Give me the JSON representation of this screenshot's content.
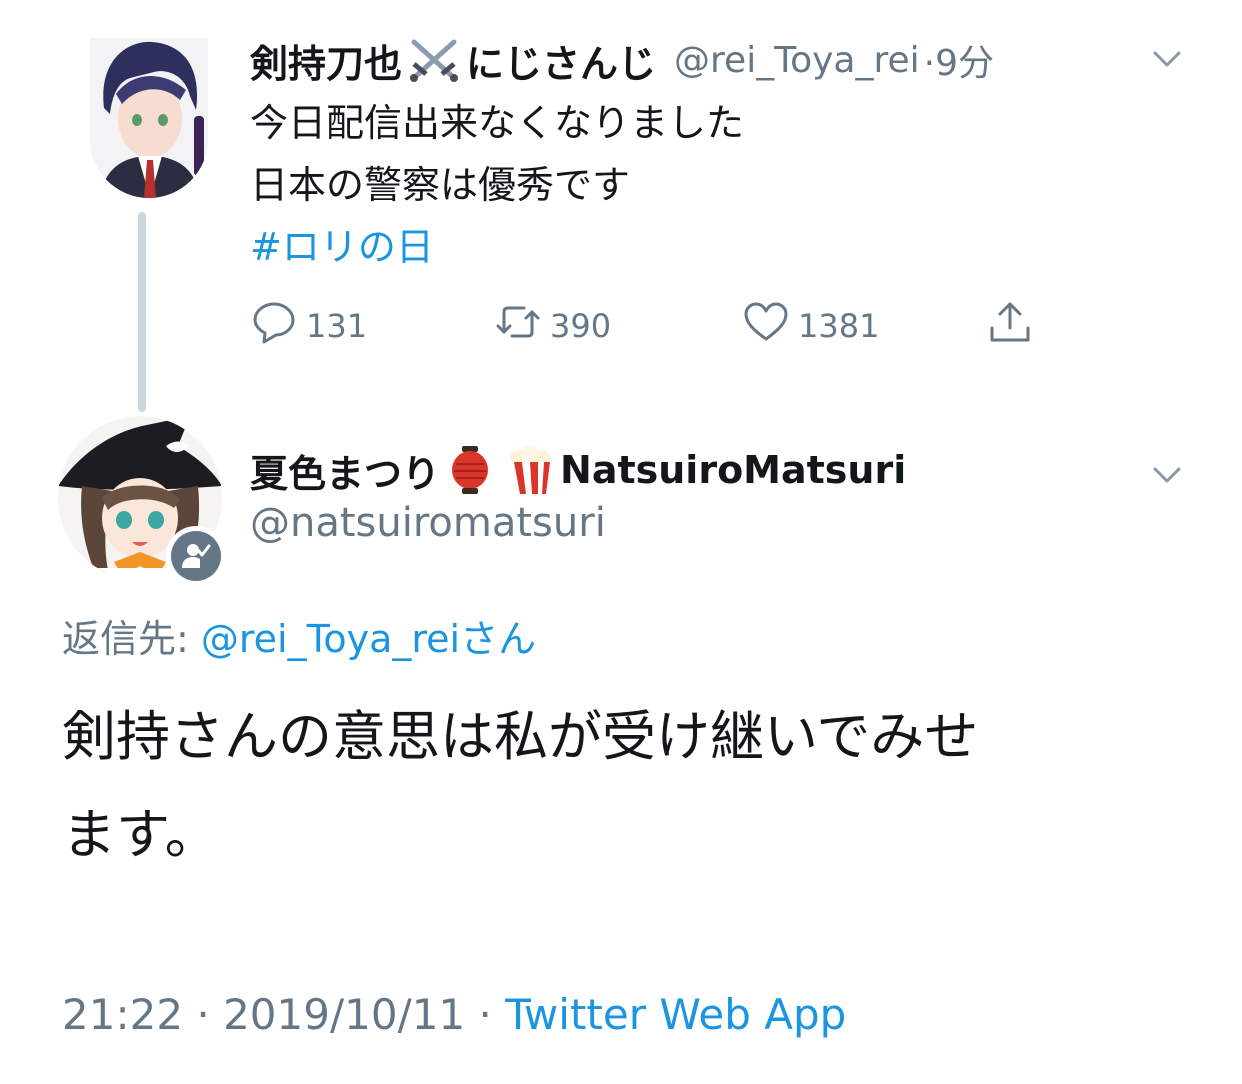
{
  "parent_tweet": {
    "display_name": "剣持刀也",
    "name_suffix": "にじさんじ",
    "handle": "@rei_Toya_rei",
    "time": "·9分",
    "text_lines": [
      "今日配信出来なくなりました",
      "日本の警察は優秀です"
    ],
    "hashtag": "#ロリの日",
    "reply_count": "131",
    "retweet_count": "390",
    "like_count": "1381"
  },
  "reply_tweet": {
    "display_name": "夏色まつり",
    "name_latin": "NatsuiroMatsuri",
    "handle": "@natsuiromatsuri",
    "replying_prefix": "返信先: ",
    "replying_mention": "@rei_Toya_rei",
    "replying_suffix": "さん",
    "text_lines": [
      "剣持さんの意思は私が受け継いでみせ",
      "ます。"
    ],
    "timestamp": "21:22 · 2019/10/11 · ",
    "source_app": "Twitter Web App"
  },
  "colors": {
    "link": "#1b95e0",
    "secondary": "#657786",
    "text": "#14171a",
    "thread_line": "#ccd6dd"
  },
  "icons": {
    "reply": "speech-bubble-icon",
    "retweet": "retweet-arrows-icon",
    "like": "heart-icon",
    "share": "share-upload-icon",
    "more": "chevron-down-icon",
    "swords": "crossed-swords-emoji",
    "lantern": "red-lantern-emoji",
    "popcorn": "popcorn-emoji",
    "badge": "user-check-badge-icon"
  }
}
